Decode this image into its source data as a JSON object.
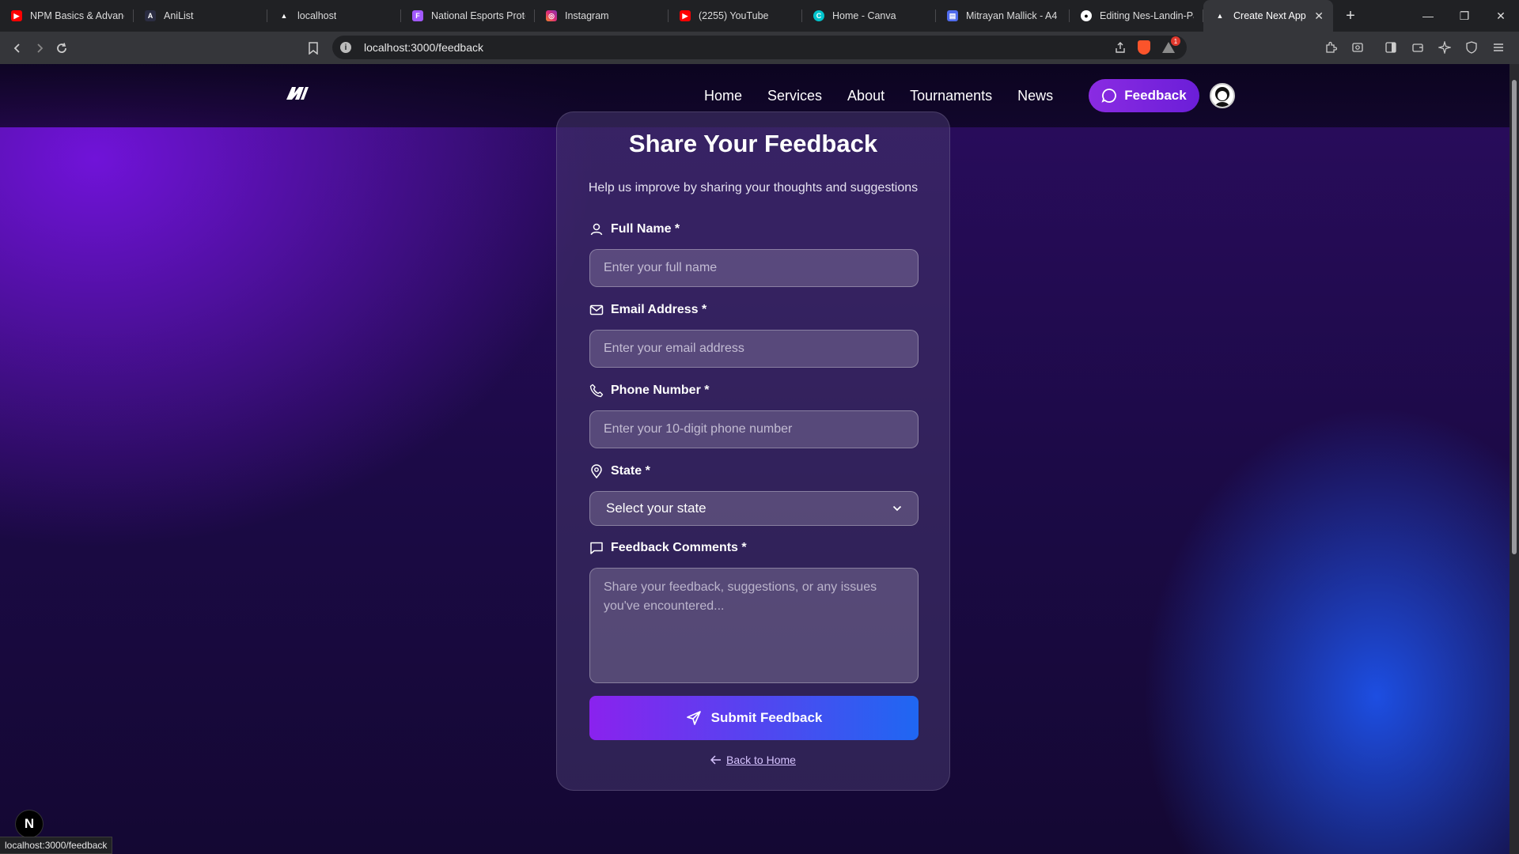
{
  "browser": {
    "tabs": [
      {
        "title": "NPM Basics & Advance",
        "icon": "youtube-icon",
        "color": "#ff0000"
      },
      {
        "title": "AniList",
        "icon": "anilist-icon",
        "color": "#2b2d42"
      },
      {
        "title": "localhost",
        "icon": "triangle-icon",
        "color": "#202124"
      },
      {
        "title": "National Esports Protot",
        "icon": "figma-icon",
        "color": "#a259ff"
      },
      {
        "title": "Instagram",
        "icon": "instagram-icon",
        "color": "#e1306c"
      },
      {
        "title": "(2255) YouTube",
        "icon": "youtube-icon",
        "color": "#ff0000"
      },
      {
        "title": "Home - Canva",
        "icon": "canva-icon",
        "color": "#00c4cc"
      },
      {
        "title": "Mitrayan Mallick - A4",
        "icon": "doc-icon",
        "color": "#4f6bed"
      },
      {
        "title": "Editing Nes-Landin-Pa",
        "icon": "github-icon",
        "color": "#ffffff"
      }
    ],
    "active_tab": "Create Next App",
    "url": "localhost:3000/feedback",
    "status_url": "localhost:3000/feedback",
    "brave_badge": "1"
  },
  "nav": {
    "links": [
      "Home",
      "Services",
      "About",
      "Tournaments",
      "News"
    ],
    "feedback_label": "Feedback"
  },
  "form": {
    "title": "Share Your Feedback",
    "subtitle": "Help us improve by sharing your thoughts and suggestions",
    "name_label": "Full Name *",
    "name_placeholder": "Enter your full name",
    "email_label": "Email Address *",
    "email_placeholder": "Enter your email address",
    "phone_label": "Phone Number *",
    "phone_placeholder": "Enter your 10-digit phone number",
    "state_label": "State *",
    "state_selected": "Select your state",
    "comments_label": "Feedback Comments *",
    "comments_placeholder": "Share your feedback, suggestions, or any issues you've encountered...",
    "submit_label": "Submit Feedback",
    "back_label": "Back to Home"
  },
  "dev_badge": "N",
  "colors": {
    "accent_purple": "#8a2be2",
    "accent_blue": "#1f67f2"
  }
}
